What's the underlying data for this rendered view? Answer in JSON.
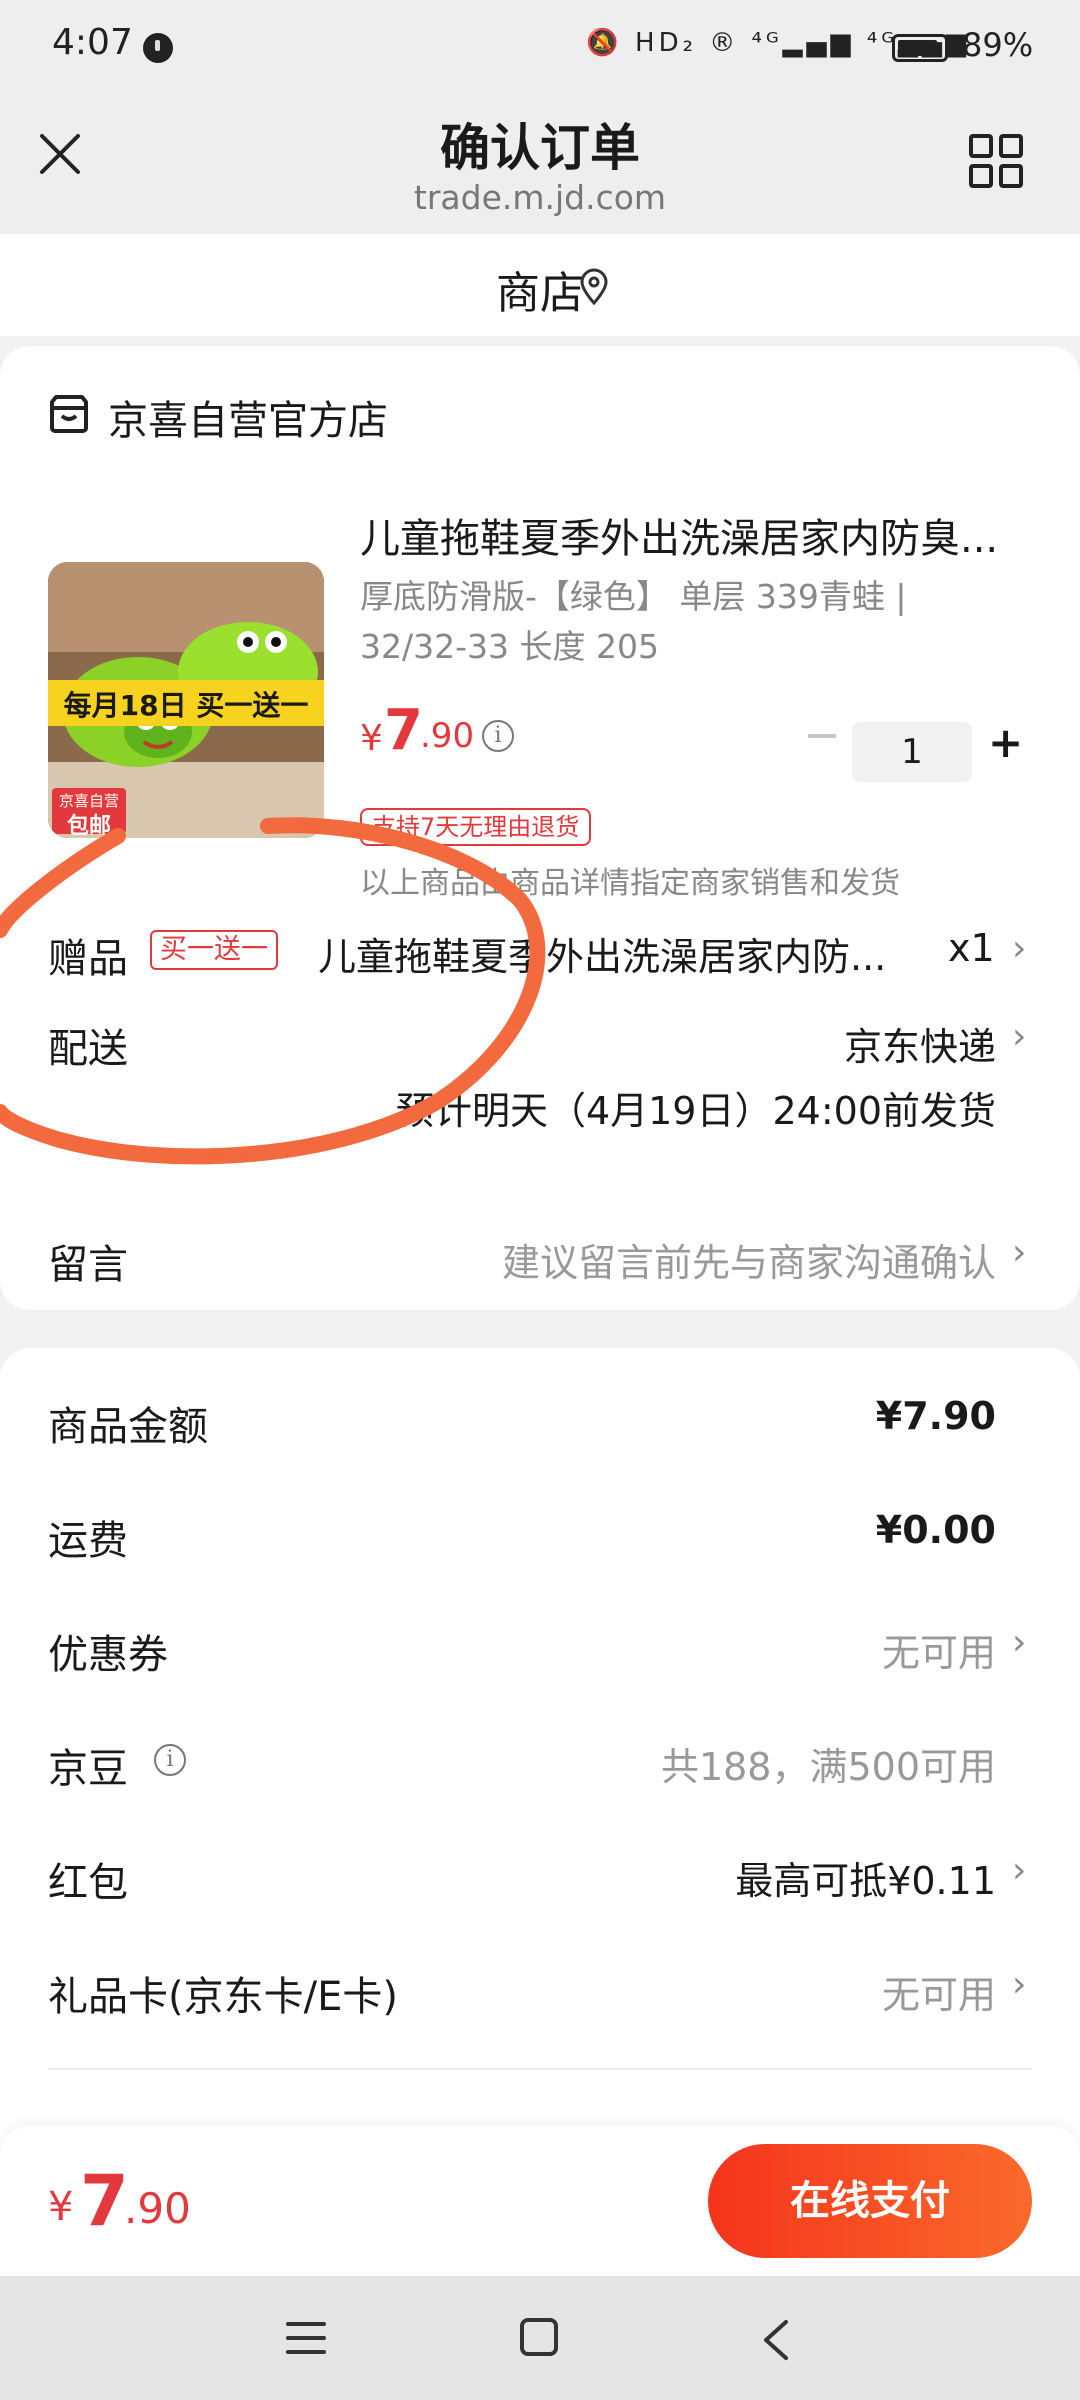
{
  "status_bar": {
    "time": "4:07",
    "icons": "🔕 HD₂ ® ⁴ᴳ▂▄▆ ⁴ᴳ▂▄▆",
    "battery": "89%",
    "battery_level_percent": 89
  },
  "header": {
    "title": "确认订单",
    "url": "trade.m.jd.com",
    "close_icon": "close-icon",
    "grid_icon": "grid-icon"
  },
  "store_bar": {
    "label": "商店",
    "icon": "location-icon"
  },
  "order": {
    "shop_name": "京喜自营官方店",
    "product": {
      "title": "儿童拖鞋夏季外出洗澡居家内防臭...",
      "spec": "厚底防滑版-【绿色】 单层 339青蛙 | 32/32-33 长度 205",
      "image_banner": "每月18日 买一送一",
      "image_badge_top": "京喜自营",
      "image_badge_bottom": "包邮",
      "price_symbol": "¥",
      "price_int": "7",
      "price_dec": ".90",
      "quantity": "1",
      "qty_minus": "−",
      "qty_plus": "+",
      "return_badge": "支持7天无理由退货",
      "seller_note": "以上商品由商品详情指定商家销售和发货"
    },
    "gift": {
      "label": "赠品",
      "badge": "买一送一",
      "description": "儿童拖鞋夏季外出洗澡居家内防...",
      "quantity": "x1"
    },
    "delivery": {
      "label": "配送",
      "value": "京东快递",
      "eta": "预计明天（4月19日）24:00前发货"
    },
    "message": {
      "label": "留言",
      "placeholder": "建议留言前先与商家沟通确认"
    }
  },
  "summary": {
    "amount_label": "商品金额",
    "amount_value": "¥7.90",
    "shipping_label": "运费",
    "shipping_value": "¥0.00",
    "coupon_label": "优惠券",
    "coupon_value": "无可用",
    "jingdou_label": "京豆",
    "jingdou_value": "共188，满500可用",
    "redpacket_label": "红包",
    "redpacket_value": "最高可抵¥0.11",
    "giftcard_label": "礼品卡(京东卡/E卡)",
    "giftcard_value": "无可用"
  },
  "bottom_bar": {
    "total_symbol": "¥",
    "total_int": "7",
    "total_dec": ".90",
    "pay_button": "在线支付"
  },
  "chevron": "›",
  "info_glyph": "i",
  "colors": {
    "accent_red": "#e4393c",
    "pay_gradient_start": "#f5341c",
    "pay_gradient_end": "#fa6a2b",
    "annotation_orange": "#f26a3d"
  }
}
